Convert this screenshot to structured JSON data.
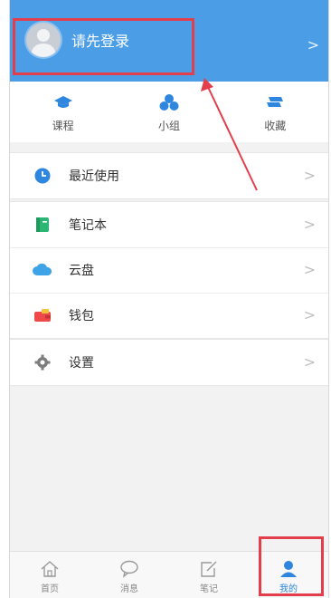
{
  "header": {
    "login_label": "请先登录",
    "chevron": ">"
  },
  "shortcuts": [
    {
      "label": "课程",
      "icon": "graduation-cap-icon"
    },
    {
      "label": "小组",
      "icon": "group-icon"
    },
    {
      "label": "收藏",
      "icon": "bookmark-stack-icon"
    }
  ],
  "menu": {
    "recent": {
      "label": "最近使用",
      "icon": "clock-icon"
    },
    "notebook": {
      "label": "笔记本",
      "icon": "notebook-icon"
    },
    "cloud": {
      "label": "云盘",
      "icon": "cloud-icon"
    },
    "wallet": {
      "label": "钱包",
      "icon": "wallet-icon"
    },
    "settings": {
      "label": "设置",
      "icon": "gear-icon"
    },
    "chevron": ">"
  },
  "tabbar": [
    {
      "label": "首页",
      "icon": "home-icon"
    },
    {
      "label": "消息",
      "icon": "chat-icon"
    },
    {
      "label": "笔记",
      "icon": "edit-note-icon"
    },
    {
      "label": "我的",
      "icon": "user-icon",
      "active": true
    }
  ],
  "colors": {
    "header_bg": "#4b9ee6",
    "accent": "#2e86de",
    "annotation_red": "#e23e4c"
  }
}
